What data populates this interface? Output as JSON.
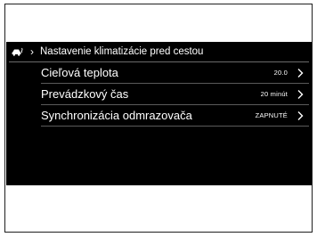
{
  "screen": {
    "title": "Nastavenie klimatizácie pred cestou",
    "icons": {
      "header": "car-climate-icon",
      "breadcrumb": "chevron-right-icon",
      "row": "chevron-right-icon"
    },
    "colors": {
      "background": "#000000",
      "text": "#ffffff",
      "divider": "#5a5a5a"
    }
  },
  "settings": [
    {
      "label": "Cieľová teplota",
      "value": "20.0"
    },
    {
      "label": "Prevádzkový čas",
      "value": "20 minút"
    },
    {
      "label": "Synchronizácia odmrazovača",
      "value": "ZAPNUTÉ"
    }
  ]
}
